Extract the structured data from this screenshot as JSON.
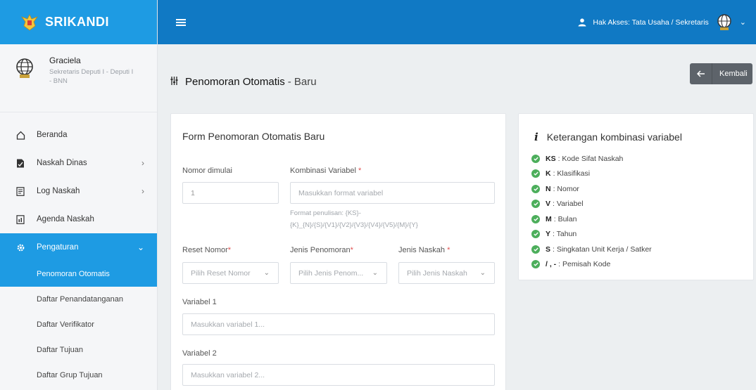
{
  "brand": {
    "name": "SRIKANDI"
  },
  "user": {
    "name": "Graciela",
    "role": "Sekretaris Deputi I - Deputi I - BNN"
  },
  "topbar": {
    "access_label": "Hak Akses: Tata Usaha / Sekretaris"
  },
  "menu": {
    "items": [
      {
        "label": "Beranda",
        "icon": "home-icon"
      },
      {
        "label": "Naskah Dinas",
        "icon": "document-icon"
      },
      {
        "label": "Log Naskah",
        "icon": "log-icon"
      },
      {
        "label": "Agenda Naskah",
        "icon": "agenda-icon"
      },
      {
        "label": "Pengaturan",
        "icon": "gear-icon"
      }
    ],
    "sub": [
      "Penomoran Otomatis",
      "Daftar Penandatanganan",
      "Daftar Verifikator",
      "Daftar Tujuan",
      "Daftar Grup Tujuan"
    ]
  },
  "page": {
    "title": "Penomoran Otomatis",
    "subtitle": "- Baru",
    "back_label": "Kembali"
  },
  "form": {
    "title": "Form Penomoran Otomatis Baru",
    "nomor_label": "Nomor dimulai",
    "nomor_value": "1",
    "kombinasi_label": "Kombinasi Variabel",
    "kombinasi_placeholder": "Masukkan format variabel",
    "hint_line1": "Format penulisan: {KS}-",
    "hint_line2": "{K}_{N}/{S}/{V1}/{V2}/{V3}/{V4}/{V5}/{M}/{Y}",
    "reset_label": "Reset Nomor",
    "reset_placeholder": "Pilih Reset Nomor",
    "jenis_pen_label": "Jenis Penomoran",
    "jenis_pen_placeholder": "Pilih Jenis Penom...",
    "jenis_naskah_label": "Jenis Naskah",
    "jenis_naskah_placeholder": "Pilih Jenis Naskah",
    "var1_label": "Variabel 1",
    "var1_placeholder": "Masukkan variabel 1...",
    "var2_label": "Variabel 2",
    "var2_placeholder": "Masukkan variabel 2...",
    "required_mark": "*"
  },
  "info": {
    "title": "Keterangan kombinasi variabel",
    "items": [
      {
        "code": "KS",
        "desc": ": Kode Sifat Naskah"
      },
      {
        "code": "K",
        "desc": ": Klasifikasi"
      },
      {
        "code": "N",
        "desc": ": Nomor"
      },
      {
        "code": "V",
        "desc": ": Variabel"
      },
      {
        "code": "M",
        "desc": ": Bulan"
      },
      {
        "code": "Y",
        "desc": ": Tahun"
      },
      {
        "code": "S",
        "desc": ": Singkatan Unit Kerja / Satker"
      },
      {
        "code": "/ , -",
        "desc": ": Pemisah Kode"
      }
    ]
  },
  "colors": {
    "primary": "#1e9be3",
    "topbar": "#1079c4",
    "success": "#4cae5b"
  }
}
